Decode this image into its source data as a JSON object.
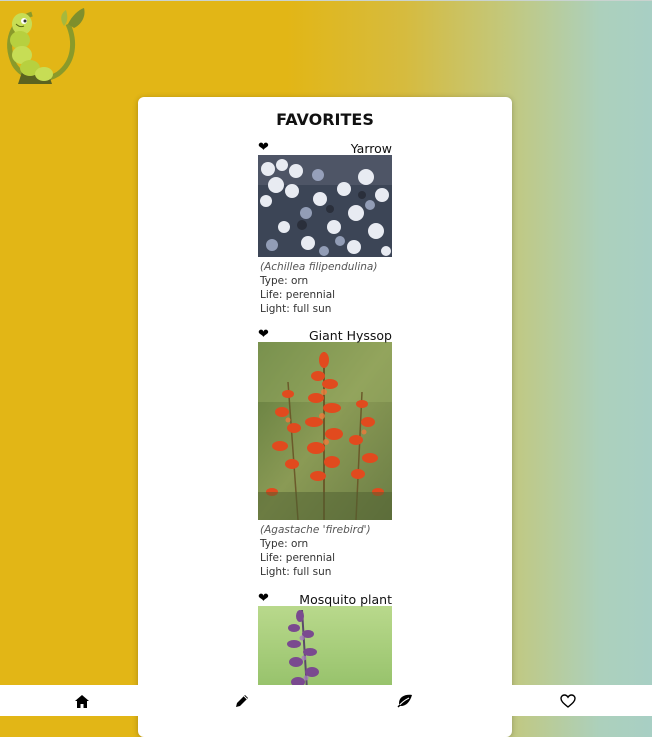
{
  "page": {
    "title": "FAVORITES"
  },
  "plants": [
    {
      "name": "Yarrow",
      "scientific": "(Achillea filipendulina)",
      "type": "Type: orn",
      "life": "Life: perennial",
      "light": "Light: full sun"
    },
    {
      "name": "Giant Hyssop",
      "scientific": "(Agastache 'firebird')",
      "type": "Type: orn",
      "life": "Life: perennial",
      "light": "Light: full sun"
    },
    {
      "name": "Mosquito plant"
    }
  ],
  "nav": {
    "items": [
      "home-icon",
      "pencil-icon",
      "leaf-icon",
      "heart-outline-icon"
    ]
  },
  "icons": {
    "favorite": "heart-icon",
    "logo": "caterpillar-logo"
  },
  "colors": {
    "background_left": "#e2b616",
    "background_right": "#a8cfc4",
    "card": "#ffffff"
  }
}
